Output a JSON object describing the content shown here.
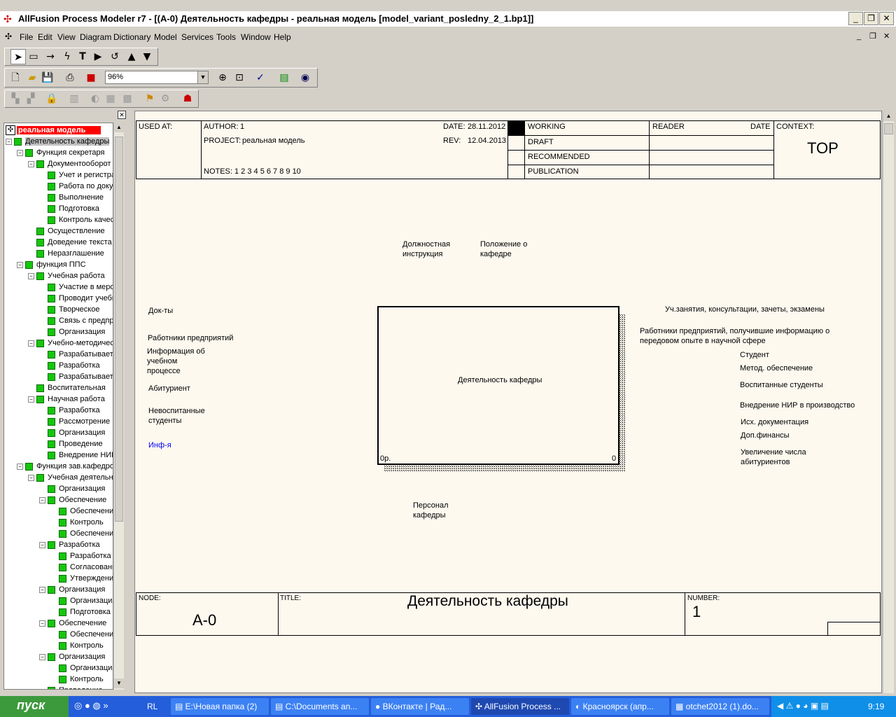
{
  "window": {
    "title": "AllFusion Process Modeler r7 - [(A-0) Деятельность кафедры - реальная модель  [model_variant_posledny_2_1.bp1]]"
  },
  "menu": [
    "File",
    "Edit",
    "View",
    "Diagram",
    "Dictionary",
    "Model",
    "Services",
    "Tools",
    "Window",
    "Help"
  ],
  "zoom": "96%",
  "tree": {
    "root": "реальная модель",
    "items": [
      "Деятельность кафедры",
      "Функция секретаря",
      "Документооборот",
      "Учет и регистрация",
      "Работа по документам",
      "Выполнение",
      "Подготовка",
      "Контроль качества",
      "Осуществление",
      "Доведение текста",
      "Неразглашение",
      "функция ППС",
      "Учебная работа",
      "Участие в  мероприятиях",
      "Проводит учебные",
      "Творческое",
      "Связь с  предприятиями",
      "Организация",
      "Учебно-методическая",
      "Разрабатывает",
      "Разработка",
      "Разрабатывает",
      "Воспитательная",
      "Научная работа",
      "Разработка",
      "Рассмотрение",
      "Организация",
      "Проведение",
      "Внедрение НИР",
      "Функция зав.кафедрой",
      "Учебная  деятельность",
      "Организация",
      "Обеспечение",
      "Обеспечение",
      "Контроль",
      "Обеспечение",
      "Разработка",
      "Разработка",
      "Согласование",
      "Утверждение",
      "Организация",
      "Организация",
      "Подготовка",
      "Обеспечение",
      "Обеспечение",
      "Контроль",
      "Организация",
      "Организация",
      "Контроль",
      "Проведение"
    ]
  },
  "header": {
    "used_at": "USED AT:",
    "author_label": "AUTHOR:",
    "author": "1",
    "project_label": "PROJECT:",
    "project": "реальная модель",
    "notes_label": "NOTES:",
    "notes": "1  2  3  4  5  6  7  8  9  10",
    "date_label": "DATE:",
    "date": "28.11.2012",
    "rev_label": "REV:",
    "rev": "12.04.2013",
    "working": "WORKING",
    "draft": "DRAFT",
    "recommended": "RECOMMENDED",
    "publication": "PUBLICATION",
    "reader": "READER",
    "date2": "DATE",
    "context": "CONTEXT:",
    "context_val": "TOP"
  },
  "box": {
    "label": "Деятельность кафедры",
    "cost": "0р.",
    "num": "0"
  },
  "controls": [
    "Должностная\nинструкция",
    "Положение о\nкафедре"
  ],
  "inputs": [
    "Док-ты",
    "Работники предприятий",
    "Информация об\nучебном\nпроцессе",
    "Абитуриент",
    "Невоспитанные\nстуденты",
    "Инф-я"
  ],
  "outputs": [
    "Уч.занятия, консультации, зачеты, экзамены",
    "Работники предприятий, получившие информацию о\nпередовом опыте в научной сфере",
    "Студент",
    "Метод. обеспечение",
    "Воспитанные студенты",
    "Внедрение НИР в производство",
    "Исх. документация",
    "Доп.финансы",
    "Увеличение числа\nабитуриентов"
  ],
  "mechanism": "Персонал\nкафедры",
  "footer": {
    "node_label": "NODE:",
    "node": "A-0",
    "title_label": "TITLE:",
    "title": "Деятельность кафедры",
    "number_label": "NUMBER:",
    "number": "1"
  },
  "taskbar": {
    "start": "пуск",
    "lang": "RL",
    "tasks": [
      "E:\\Новая папка (2)",
      "C:\\Documents an...",
      "ВКонтакте | Рад...",
      "AllFusion Process ...",
      "Красноярск (апр...",
      "otchet2012 (1).do..."
    ],
    "time": "9:19"
  },
  "colors": {
    "tree_box": "#16c60c",
    "root_bg": "#ff0000",
    "inf_arrow": "#0000ff",
    "taskbar": "#245edb"
  }
}
